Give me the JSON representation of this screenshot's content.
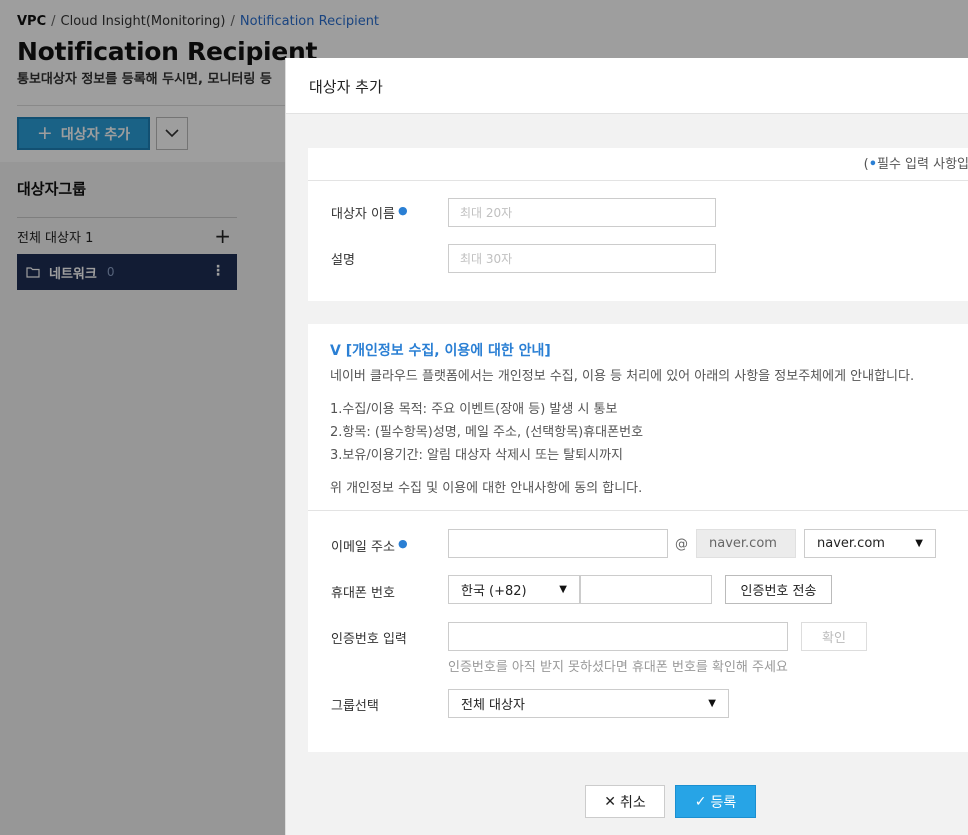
{
  "breadcrumb": {
    "root": "VPC",
    "sep1": "/",
    "middle": "Cloud Insight(Monitoring)",
    "sep2": "/",
    "current": "Notification Recipient"
  },
  "page": {
    "title": "Notification Recipient",
    "description": "통보대상자 정보를 등록해 두시면, 모니터링 등",
    "add_button_label": "대상자 추가"
  },
  "sidebar": {
    "title": "대상자그룹",
    "all_recipients_label": "전체 대상자 1",
    "groups": [
      {
        "name": "네트워크",
        "count": "0"
      }
    ]
  },
  "modal": {
    "title": "대상자 추가",
    "required_note_open": "(",
    "required_note_dot": "•",
    "required_note_text": "필수 입력 사항입",
    "name_label": "대상자 이름",
    "name_placeholder": "최대 20자",
    "desc_label": "설명",
    "desc_placeholder": "최대 30자",
    "privacy_title": "V [개인정보 수집, 이용에 대한 안내]",
    "privacy_intro": "네이버 클라우드 플랫폼에서는 개인정보 수집, 이용 등 처리에 있어 아래의 사항을 정보주체에게 안내합니다.",
    "privacy_items": [
      "1.수집/이용 목적: 주요 이벤트(장애 등) 발생 시 통보",
      "2.항목: (필수항목)성명, 메일 주소, (선택항목)휴대폰번호",
      "3.보유/이용기간: 알림 대상자 삭제시 또는 탈퇴시까지"
    ],
    "privacy_consent": "위 개인정보 수집 및 이용에 대한 안내사항에 동의 합니다.",
    "email_label": "이메일 주소",
    "email_value": "",
    "at_sign": "@",
    "email_domain_value": "naver.com",
    "email_domain_select": "naver.com",
    "phone_label": "휴대폰 번호",
    "country_code": "한국 (+82)",
    "phone_value": "",
    "send_code_button": "인증번호 전송",
    "code_label": "인증번호 입력",
    "code_value": "",
    "confirm_button": "확인",
    "code_hint": "인증번호를 아직 받지 못하셨다면 휴대폰 번호를 확인해 주세요",
    "group_label": "그룹선택",
    "group_value": "전체 대상자",
    "cancel_button": "취소",
    "submit_button": "등록"
  },
  "colors": {
    "accent": "#2b9fd9",
    "required_dot": "#2a7fd4",
    "group_active_bg": "#1d2e55"
  }
}
